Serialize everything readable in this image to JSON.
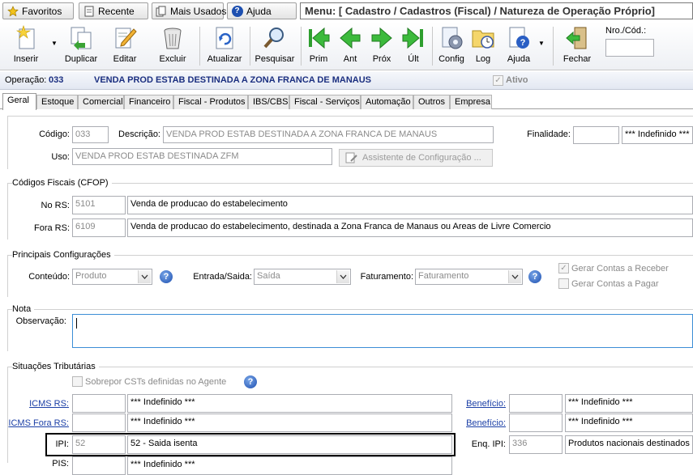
{
  "topbar": {
    "favoritos": "Favoritos",
    "recente": "Recente",
    "mais_usados": "Mais Usados",
    "ajuda": "Ajuda",
    "menu_path": "Menu: [ Cadastro / Cadastros (Fiscal) / Natureza de Operação Próprio]"
  },
  "toolbar": {
    "inserir": "Inserir",
    "duplicar": "Duplicar",
    "editar": "Editar",
    "excluir": "Excluir",
    "atualizar": "Atualizar",
    "pesquisar": "Pesquisar",
    "prim": "Prim",
    "ant": "Ant",
    "prox": "Próx",
    "ult": "Últ",
    "config": "Config",
    "log": "Log",
    "ajuda": "Ajuda",
    "fechar": "Fechar",
    "nro_label": "Nro./Cód.:",
    "nro_value": ""
  },
  "operation": {
    "label": "Operação:",
    "code": "033",
    "description": "VENDA PROD ESTAB DESTINADA A ZONA FRANCA DE MANAUS",
    "ativo_label": "Ativo",
    "ativo_checked": true
  },
  "tabs": [
    "Geral",
    "Estoque",
    "Comercial",
    "Financeiro",
    "Fiscal - Produtos",
    "IBS/CBS",
    "Fiscal - Serviços",
    "Automação",
    "Outros",
    "Empresa"
  ],
  "general": {
    "codigo_label": "Código:",
    "codigo_value": "033",
    "descricao_label": "Descrição:",
    "descricao_value": "VENDA PROD ESTAB DESTINADA A ZONA FRANCA DE MANAUS",
    "finalidade_label": "Finalidade:",
    "finalidade_code": "",
    "finalidade_value": "*** Indefinido ***",
    "uso_label": "Uso:",
    "uso_value": "VENDA PROD ESTAB DESTINADA ZFM",
    "assistente_label": "Assistente de Configuração ..."
  },
  "cfop": {
    "title": "Códigos Fiscais (CFOP)",
    "no_rs_label": "No RS:",
    "no_rs_code": "5101",
    "no_rs_desc": "Venda de producao do estabelecimento",
    "fora_rs_label": "Fora RS:",
    "fora_rs_code": "6109",
    "fora_rs_desc": "Venda de producao do estabelecimento, destinada a Zona Franca de Manaus ou Areas de Livre Comercio"
  },
  "config": {
    "title": "Principais Configurações",
    "conteudo_label": "Conteúdo:",
    "conteudo_value": "Produto",
    "entrada_saida_label": "Entrada/Saida:",
    "entrada_saida_value": "Saída",
    "faturamento_label": "Faturamento:",
    "faturamento_value": "Faturamento",
    "gerar_receber_label": "Gerar Contas a Receber",
    "gerar_receber_checked": true,
    "gerar_pagar_label": "Gerar Contas a Pagar",
    "gerar_pagar_checked": false
  },
  "nota": {
    "title": "Nota",
    "observacao_label": "Observação:",
    "observacao_value": ""
  },
  "situacoes": {
    "title": "Situações Tributárias",
    "sobrepor_label": "Sobrepor CSTs definidas no Agente",
    "icms_rs_label": "ICMS RS:",
    "icms_rs_code": "",
    "icms_rs_desc": "*** Indefinido ***",
    "icms_fora_label": "ICMS Fora RS:",
    "icms_fora_code": "",
    "icms_fora_desc": "*** Indefinido ***",
    "ipi_label": "IPI:",
    "ipi_code": "52",
    "ipi_desc": "52 - Saida isenta",
    "pis_label": "PIS:",
    "pis_desc": "*** Indefinido ***",
    "beneficio1_label": "Benefício:",
    "beneficio1_code": "",
    "beneficio1_desc": "*** Indefinido ***",
    "beneficio2_label": "Benefício:",
    "beneficio2_code": "",
    "beneficio2_desc": "*** Indefinido ***",
    "enq_ipi_label": "Enq. IPI:",
    "enq_ipi_code": "336",
    "enq_ipi_desc": "Produtos nacionais destinados à"
  }
}
